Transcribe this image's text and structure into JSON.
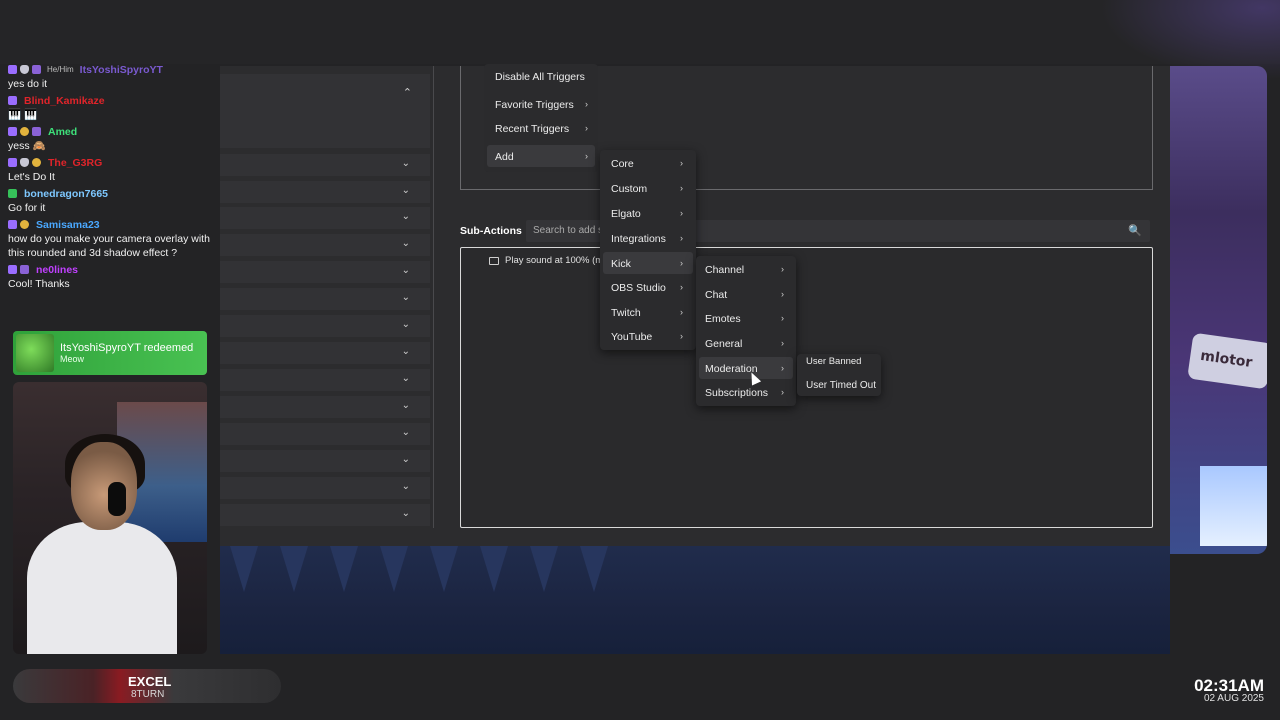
{
  "chat": {
    "messages": [
      {
        "pronoun": "He/Him",
        "user": "ItsYoshiSpyroYT",
        "user_color": "#7a5ad0",
        "text": "yes do it"
      },
      {
        "pronoun": "",
        "user": "Blind_Kamikaze",
        "user_color": "#e0242a",
        "text": "🎹 🎹"
      },
      {
        "pronoun": "",
        "user": "Amed",
        "user_color": "#3ee07a",
        "text": "yess 🙈"
      },
      {
        "pronoun": "",
        "user": "The_G3RG",
        "user_color": "#e0242a",
        "text": "Let's Do It"
      },
      {
        "pronoun": "",
        "user": "bonedragon7665",
        "user_color": "#7ec8ff",
        "text": "Go for it"
      },
      {
        "pronoun": "",
        "user": "Samisama23",
        "user_color": "#4aa8ff",
        "text": "how do you make your camera overlay with this rounded and 3d shadow effect ?"
      },
      {
        "pronoun": "",
        "user": "ne0lines",
        "user_color": "#c040ff",
        "text": "Cool! Thanks"
      }
    ],
    "redeem": {
      "title": "ItsYoshiSpyroYT redeemed",
      "reward": "Meow"
    }
  },
  "triggers_menu": {
    "items": [
      {
        "label": "Disable All Triggers",
        "has_arrow": false
      },
      {
        "label": "Favorite Triggers",
        "has_arrow": true
      },
      {
        "label": "Recent Triggers",
        "has_arrow": true
      },
      {
        "label": "Add",
        "has_arrow": true
      }
    ]
  },
  "sub_actions": {
    "label": "Sub-Actions",
    "search_placeholder": "Search to add s",
    "item": "Play sound at 100% (me"
  },
  "menu_add": {
    "items": [
      "Core",
      "Custom",
      "Elgato",
      "Integrations",
      "Kick",
      "OBS Studio",
      "Twitch",
      "YouTube"
    ],
    "highlighted": "Kick"
  },
  "menu_kick": {
    "items": [
      "Channel",
      "Chat",
      "Emotes",
      "General",
      "Moderation",
      "Subscriptions"
    ],
    "highlighted": "Moderation"
  },
  "menu_moderation": {
    "items": [
      "User Banned",
      "User Timed Out"
    ]
  },
  "game_sign": "mlotor",
  "footer": {
    "title": "EXCEL",
    "subtitle": "8TURN"
  },
  "clock": {
    "time": "02:31AM",
    "date": "02 AUG 2025"
  },
  "icons": {
    "chevron_down": "⌄",
    "chevron_up": "⌃",
    "chevron_right": "›",
    "search": "🔍"
  }
}
